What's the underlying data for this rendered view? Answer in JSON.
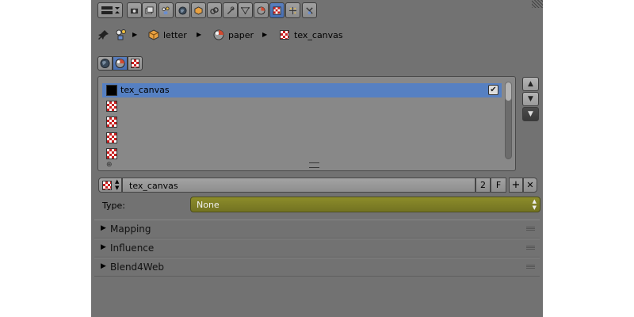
{
  "header": {
    "tabs": [
      {
        "icon": "render-icon"
      },
      {
        "icon": "render-layers-icon"
      },
      {
        "icon": "scene-icon"
      },
      {
        "icon": "world-icon"
      },
      {
        "icon": "object-icon"
      },
      {
        "icon": "constraints-icon"
      },
      {
        "icon": "modifier-icon"
      },
      {
        "icon": "data-icon"
      },
      {
        "icon": "material-icon"
      },
      {
        "icon": "texture-icon"
      },
      {
        "icon": "particles-icon"
      },
      {
        "icon": "physics-icon"
      }
    ],
    "active_tab": "texture-icon"
  },
  "breadcrumb": {
    "items": [
      "letter",
      "paper",
      "tex_canvas"
    ]
  },
  "texture_slots": {
    "rows": [
      {
        "name": "tex_canvas",
        "selected": true,
        "enabled": true
      },
      {
        "name": ""
      },
      {
        "name": ""
      },
      {
        "name": ""
      },
      {
        "name": ""
      }
    ]
  },
  "side_buttons": {
    "up": "▲",
    "down": "▼",
    "menu": "▼"
  },
  "texture": {
    "name": "tex_canvas",
    "users": "2",
    "fake_user": "F",
    "add_symbol": "+",
    "remove_symbol": "✕"
  },
  "type_field": {
    "label": "Type:",
    "value": "None"
  },
  "panels": [
    "Mapping",
    "Influence",
    "Blend4Web"
  ],
  "colors": {
    "panel_bg": "#727272",
    "selected_row": "#5680c2",
    "type_select": "#8c8c2a",
    "active_tab": "#5a7fbf"
  }
}
